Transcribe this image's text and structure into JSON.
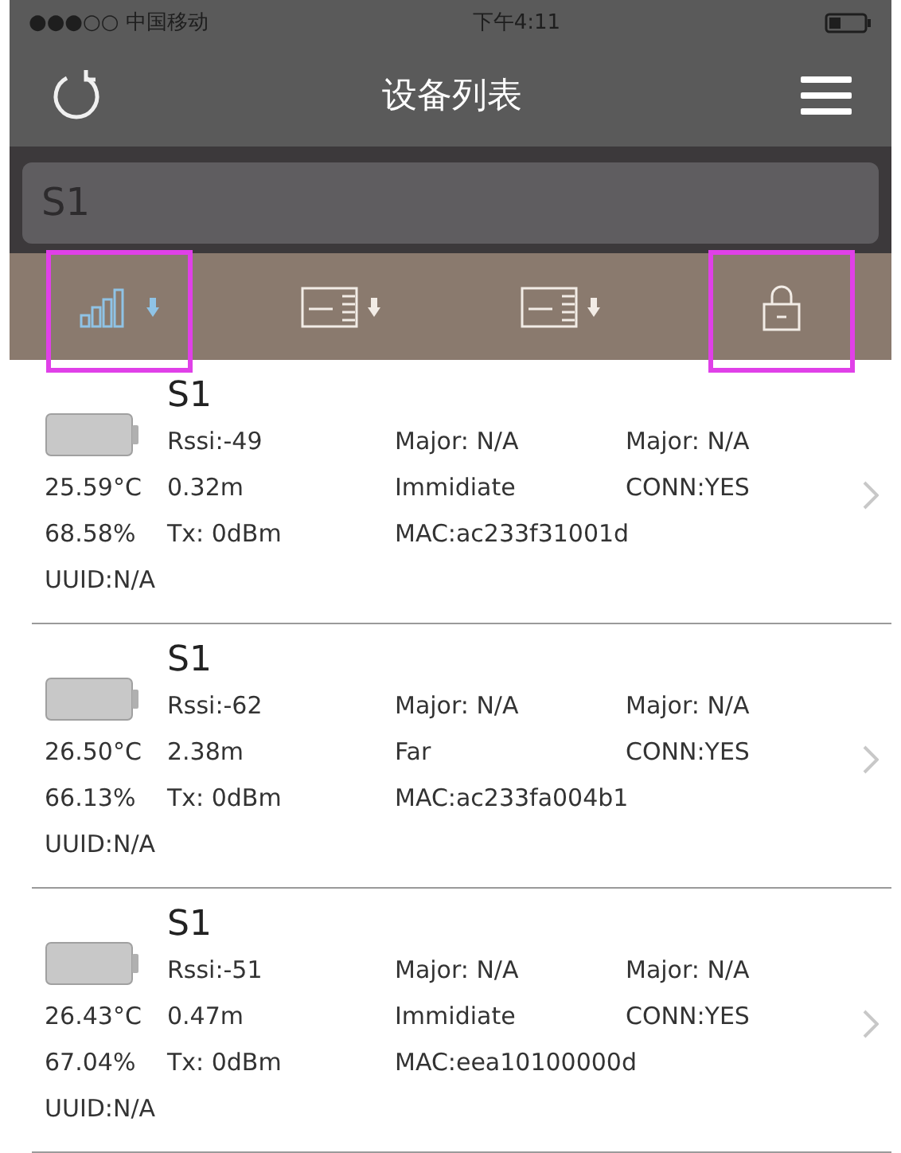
{
  "status_bar": {
    "carrier": "●●●○○ 中国移动",
    "time": "下午4:11"
  },
  "nav_bar": {
    "title": "设备列表"
  },
  "search": {
    "value": "S1"
  },
  "sort_bar": [
    {
      "kind": "signal",
      "selected": true,
      "highlighted": true
    },
    {
      "kind": "card",
      "selected": false,
      "highlighted": false
    },
    {
      "kind": "card",
      "selected": false,
      "highlighted": false
    },
    {
      "kind": "lock",
      "selected": false,
      "highlighted": true
    }
  ],
  "devices": [
    {
      "name": "S1",
      "rssi": "Rssi:-49",
      "major": "Major: N/A",
      "minor": "Major: N/A",
      "temperature": "25.59°C",
      "distance": "0.32m",
      "proximity": "Immidiate",
      "connectable": "CONN:YES",
      "battery": "68.58%",
      "tx_power": "Tx: 0dBm",
      "mac": "MAC:ac233f31001d",
      "uuid": "UUID:N/A"
    },
    {
      "name": "S1",
      "rssi": "Rssi:-62",
      "major": "Major: N/A",
      "minor": "Major: N/A",
      "temperature": "26.50°C",
      "distance": "2.38m",
      "proximity": "Far",
      "connectable": "CONN:YES",
      "battery": "66.13%",
      "tx_power": "Tx: 0dBm",
      "mac": "MAC:ac233fa004b1",
      "uuid": "UUID:N/A"
    },
    {
      "name": "S1",
      "rssi": "Rssi:-51",
      "major": "Major: N/A",
      "minor": "Major: N/A",
      "temperature": "26.43°C",
      "distance": "0.47m",
      "proximity": "Immidiate",
      "connectable": "CONN:YES",
      "battery": "67.04%",
      "tx_power": "Tx: 0dBm",
      "mac": "MAC:eea10100000d",
      "uuid": "UUID:N/A"
    }
  ]
}
